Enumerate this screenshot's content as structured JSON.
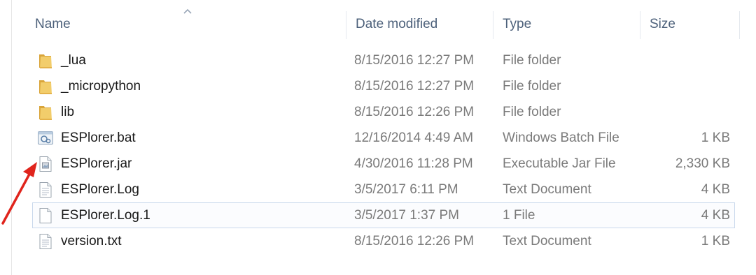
{
  "columns": {
    "name": "Name",
    "date_modified": "Date modified",
    "type": "Type",
    "size": "Size"
  },
  "sort_indicator": "caret-up-icon",
  "colors": {
    "header_text": "#4c607a",
    "selection_border": "#c9d8ec",
    "annotation_arrow": "#e0241c",
    "folder": "#e9b949"
  },
  "files": [
    {
      "name": "_lua",
      "date": "8/15/2016 12:27 PM",
      "type": "File folder",
      "size": "",
      "icon": "folder-icon"
    },
    {
      "name": "_micropython",
      "date": "8/15/2016 12:27 PM",
      "type": "File folder",
      "size": "",
      "icon": "folder-icon"
    },
    {
      "name": "lib",
      "date": "8/15/2016 12:26 PM",
      "type": "File folder",
      "size": "",
      "icon": "folder-icon"
    },
    {
      "name": "ESPlorer.bat",
      "date": "12/16/2014 4:49 AM",
      "type": "Windows Batch File",
      "size": "1 KB",
      "icon": "batch-file-icon"
    },
    {
      "name": "ESPlorer.jar",
      "date": "4/30/2016 11:28 PM",
      "type": "Executable Jar File",
      "size": "2,330 KB",
      "icon": "jar-file-icon"
    },
    {
      "name": "ESPlorer.Log",
      "date": "3/5/2017 6:11 PM",
      "type": "Text Document",
      "size": "4 KB",
      "icon": "text-document-icon"
    },
    {
      "name": "ESPlorer.Log.1",
      "date": "3/5/2017 1:37 PM",
      "type": "1 File",
      "size": "4 KB",
      "icon": "generic-file-icon",
      "selected": true
    },
    {
      "name": "version.txt",
      "date": "8/15/2016 12:26 PM",
      "type": "Text Document",
      "size": "1 KB",
      "icon": "text-document-icon"
    }
  ]
}
